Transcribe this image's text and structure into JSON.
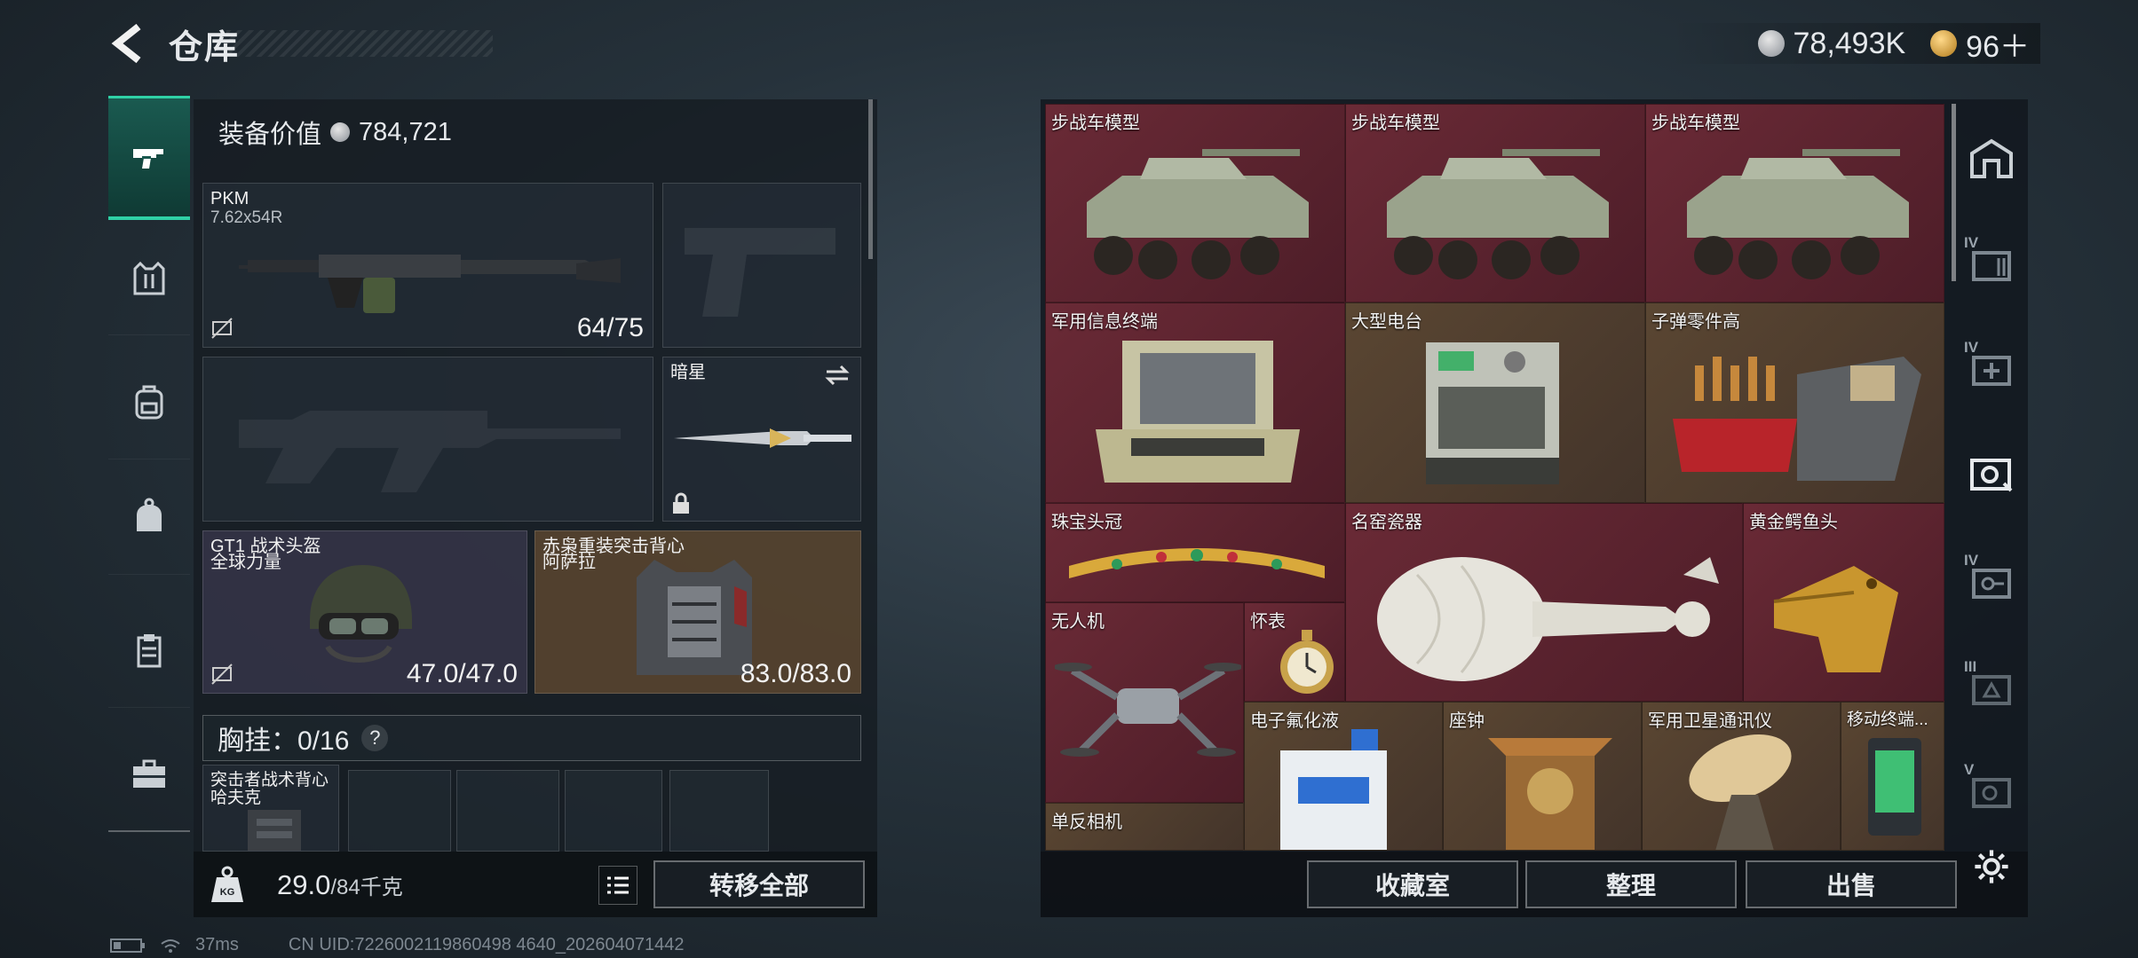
{
  "header": {
    "title": "仓库",
    "currency_silver": "78,493K",
    "currency_gold": "96＋"
  },
  "sidebar": {
    "items": [
      "gun-icon",
      "vest-icon",
      "backpack-icon",
      "bag-icon",
      "clipboard-icon",
      "toolbox-icon"
    ],
    "active_index": 0
  },
  "equipment": {
    "value_label": "装备价值",
    "value": "784,721",
    "primary": {
      "name": "PKM",
      "caliber": "7.62x54R",
      "durability": "64/75"
    },
    "helmet": {
      "name": "GT1 战术头盔",
      "sub": "全球力量",
      "durability": "47.0/47.0"
    },
    "armor": {
      "name": "赤枭重装突击背心",
      "sub": "阿萨拉",
      "durability": "83.0/83.0"
    },
    "melee": {
      "name": "暗星"
    },
    "chest_rig": {
      "label": "胸挂：0/16",
      "help": "?"
    },
    "rig_item": {
      "name": "突击者战术背心",
      "sub": "哈夫克"
    }
  },
  "bottom_left": {
    "weight": "29.0",
    "weight_max": "/84千克",
    "transfer_label": "转移全部"
  },
  "storage": {
    "items": [
      {
        "label": "步战车模型"
      },
      {
        "label": "步战车模型"
      },
      {
        "label": "步战车模型"
      },
      {
        "label": "军用信息终端"
      },
      {
        "label": "大型电台"
      },
      {
        "label": "子弹零件高"
      },
      {
        "label": "珠宝头冠"
      },
      {
        "label": "名窑瓷器"
      },
      {
        "label": "黄金鳄鱼头"
      },
      {
        "label": "无人机"
      },
      {
        "label": "怀表"
      },
      {
        "label": "电子氟化液"
      },
      {
        "label": "座钟"
      },
      {
        "label": "军用卫星通讯仪"
      },
      {
        "label": "移动终端..."
      },
      {
        "label": "单反相机"
      }
    ]
  },
  "actions": {
    "collection": "收藏室",
    "sort": "整理",
    "sell": "出售"
  },
  "right_sidebar": {
    "tiers": [
      "IV",
      "IV",
      "IV",
      "III",
      "V"
    ]
  },
  "status": {
    "ping": "37ms",
    "uid": "CN UID:7226002119860498 4640_202604071442"
  },
  "colors": {
    "accent": "#2fd1a6",
    "rare_red": "#6a2a36",
    "rare_brown": "#5a4632"
  }
}
